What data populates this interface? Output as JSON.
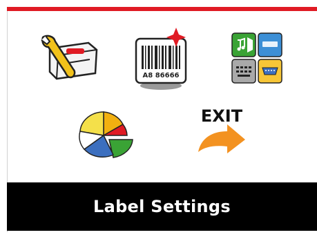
{
  "menu": {
    "items": [
      {
        "icon": "printer-wrench-icon"
      },
      {
        "icon": "barcode-label-icon",
        "label_text": "A8 86666"
      },
      {
        "icon": "ports-interface-icon"
      },
      {
        "icon": "pie-chart-icon"
      },
      {
        "icon": "exit-arrow-icon",
        "label_text": "EXIT"
      }
    ]
  },
  "footer": {
    "title": "Label Settings"
  },
  "colors": {
    "accent_bar": "#e01b24",
    "footer_background": "#000000",
    "footer_text": "#ffffff",
    "exit_arrow": "#f39221"
  }
}
